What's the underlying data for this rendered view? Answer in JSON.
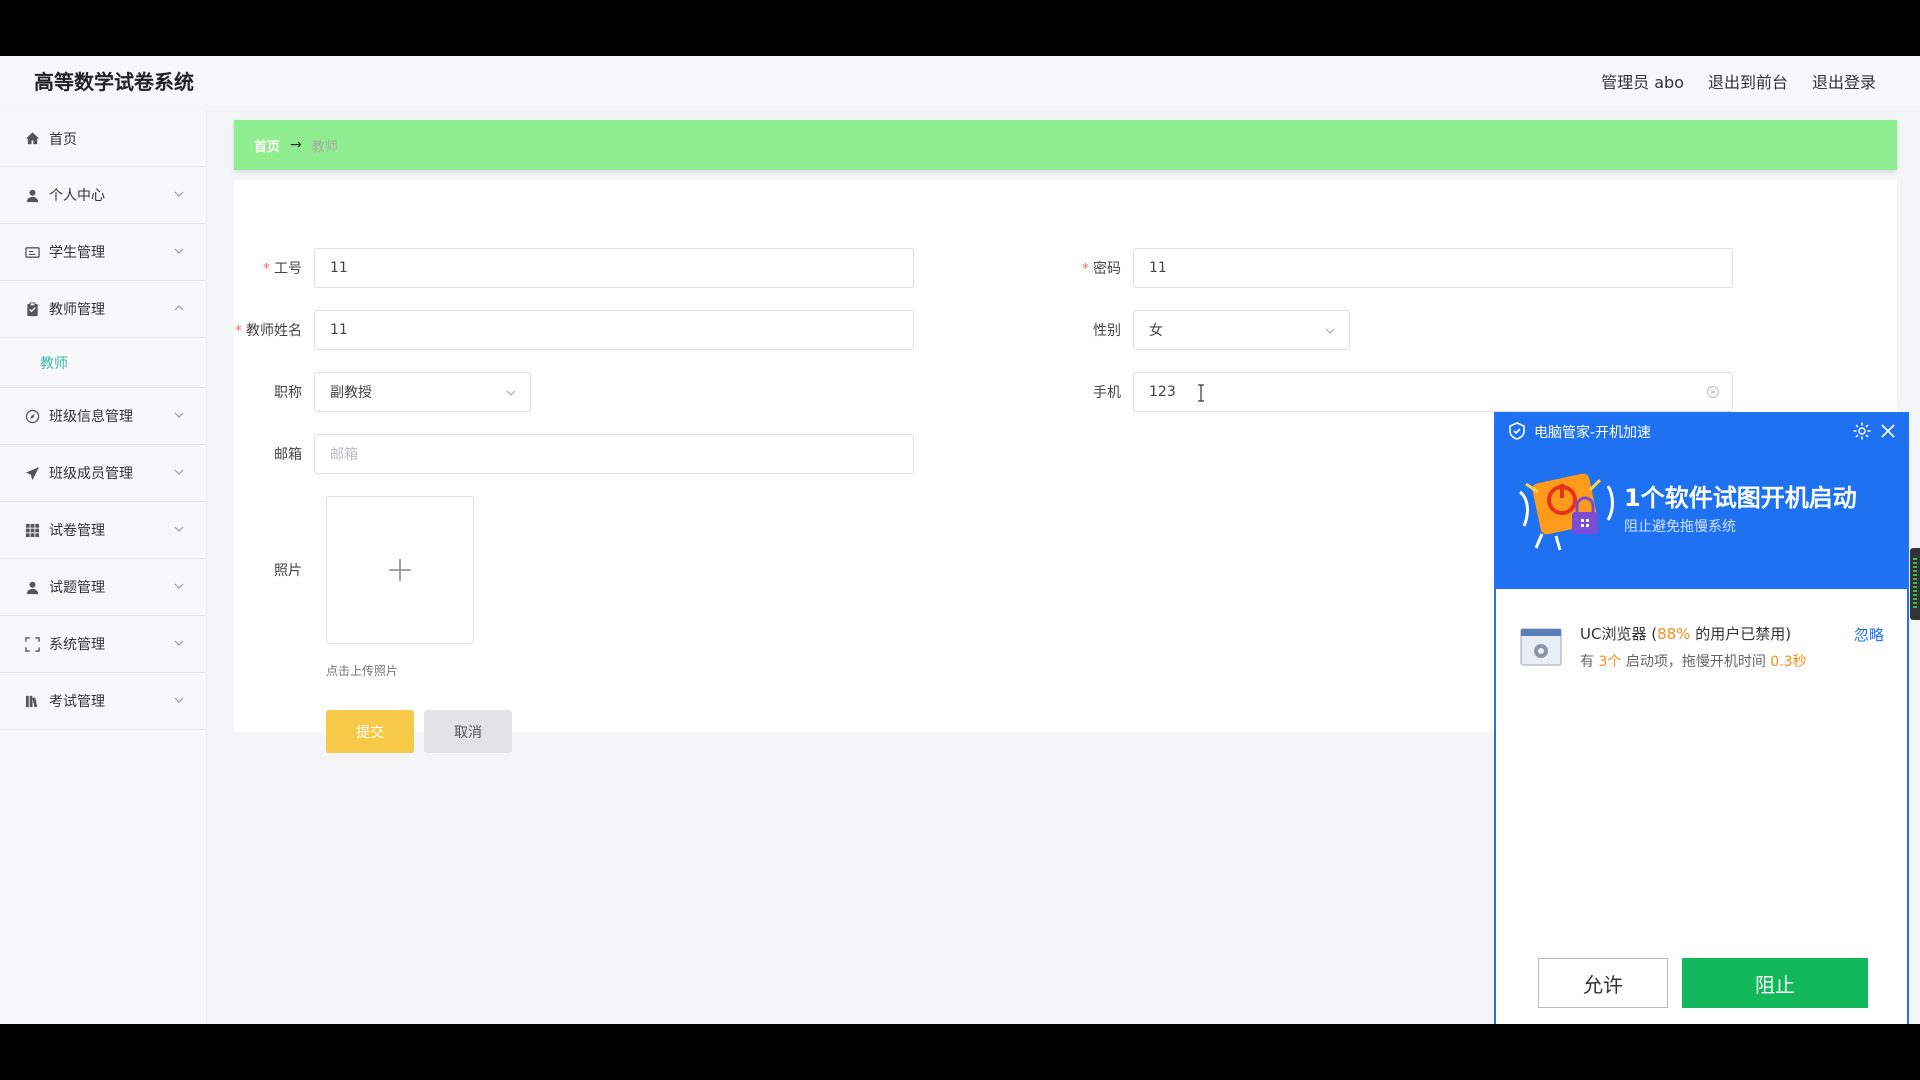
{
  "header": {
    "title": "高等数学试卷系统",
    "links": [
      "管理员 abo",
      "退出到前台",
      "退出登录"
    ]
  },
  "sidebar": {
    "items": [
      {
        "label": "首页",
        "icon": "home-icon"
      },
      {
        "label": "个人中心",
        "icon": "user-icon"
      },
      {
        "label": "学生管理",
        "icon": "id-card-icon"
      },
      {
        "label": "教师管理",
        "icon": "clipboard-icon",
        "expanded": true
      },
      {
        "label": "班级信息管理",
        "icon": "compass-icon"
      },
      {
        "label": "班级成员管理",
        "icon": "send-icon"
      },
      {
        "label": "试卷管理",
        "icon": "grid-icon"
      },
      {
        "label": "试题管理",
        "icon": "user-icon"
      },
      {
        "label": "系统管理",
        "icon": "fullscreen-icon"
      },
      {
        "label": "考试管理",
        "icon": "library-icon"
      }
    ],
    "sub_item": "教师"
  },
  "breadcrumb": {
    "home": "首页",
    "arrow": "→",
    "current": "教师"
  },
  "form": {
    "gonghao": {
      "label": "工号",
      "value": "11"
    },
    "mima": {
      "label": "密码",
      "value": "11"
    },
    "jiaoshixingming": {
      "label": "教师姓名",
      "value": "11"
    },
    "xingbie": {
      "label": "性别",
      "value": "女"
    },
    "zhicheng": {
      "label": "职称",
      "value": "副教授"
    },
    "shouji": {
      "label": "手机",
      "value": "123"
    },
    "youxiang": {
      "label": "邮箱",
      "placeholder": "邮箱"
    },
    "zhaopian": {
      "label": "照片",
      "hint": "点击上传照片"
    },
    "submit": "提交",
    "cancel": "取消"
  },
  "popup": {
    "title": "电脑管家-开机加速",
    "headline": "1个软件试图开机启动",
    "subline": "阻止避免拖慢系统",
    "app_name": "UC浏览器",
    "pct_pre": "(",
    "pct": "88%",
    "pct_post": " 的用户已禁用)",
    "l2_a": "有 ",
    "count": "3个",
    "l2_b": " 启动项，拖慢开机时间 ",
    "time": "0.3秒",
    "ignore": "忽略",
    "allow": "允许",
    "block": "阻止"
  },
  "colors": {
    "breadcrumb": "#90ee90",
    "submit": "#f7c948",
    "popup_blue": "#1e72f2",
    "block_green": "#13b85a",
    "accent": "#3dbaa6"
  }
}
